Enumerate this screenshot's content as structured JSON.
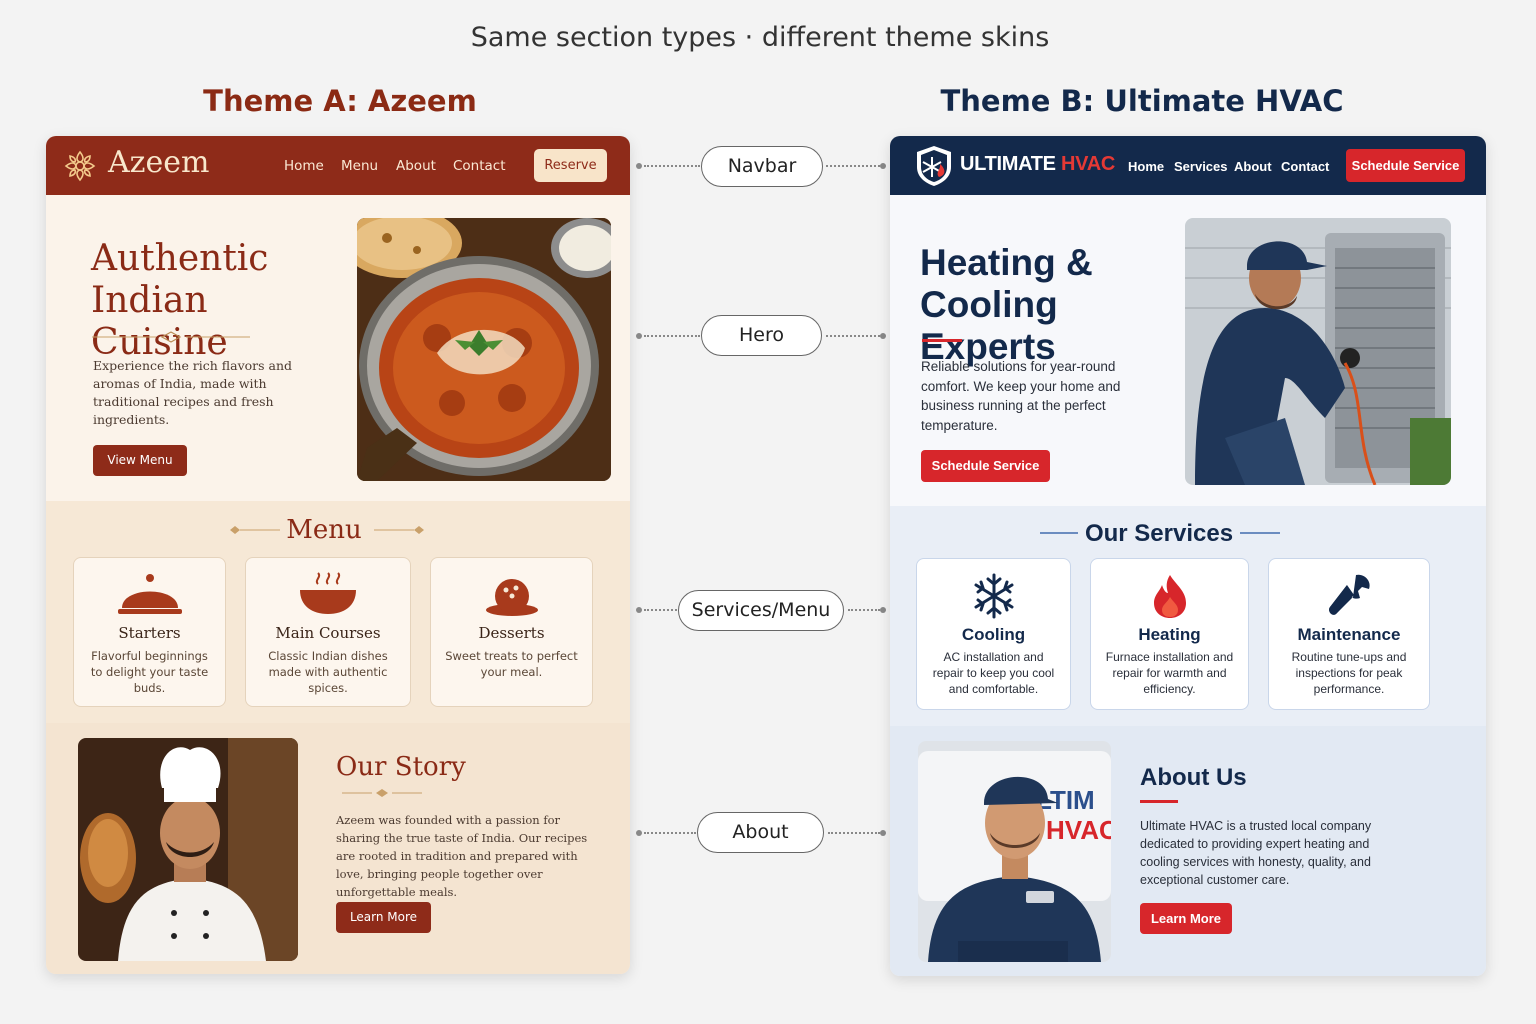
{
  "header": {
    "title": "Same section types  ·  different theme skins"
  },
  "theme_a": {
    "label": "Theme A: Azeem",
    "nav": {
      "logo": "Azeem",
      "links": [
        "Home",
        "Menu",
        "About",
        "Contact"
      ],
      "cta": "Reserve"
    },
    "hero": {
      "title": "Authentic Indian Cuisine",
      "description": "Experience the rich flavors and aromas of India, made with traditional recipes and fresh ingredients.",
      "button": "View Menu"
    },
    "menu": {
      "title": "Menu",
      "items": [
        {
          "title": "Starters",
          "desc": "Flavorful beginnings to delight your taste buds.",
          "icon": "cloche-icon"
        },
        {
          "title": "Main Courses",
          "desc": "Classic Indian dishes made with authentic spices.",
          "icon": "bowl-icon"
        },
        {
          "title": "Desserts",
          "desc": "Sweet treats to perfect your meal.",
          "icon": "dessert-icon"
        }
      ]
    },
    "about": {
      "title": "Our Story",
      "text": "Azeem was founded with a passion for sharing the true taste of India. Our recipes are rooted in tradition and prepared with love, bringing people together over unforgettable meals.",
      "button": "Learn More"
    },
    "colors": {
      "primary": "#8e2b19",
      "background": "#fbf3e9"
    }
  },
  "theme_b": {
    "label": "Theme B: Ultimate HVAC",
    "nav": {
      "logo_main": "ULTIMATE",
      "logo_accent": "HVAC",
      "links": [
        "Home",
        "Services",
        "About",
        "Contact"
      ],
      "cta": "Schedule Service"
    },
    "hero": {
      "title": "Heating & Cooling Experts",
      "description": "Reliable solutions for year-round comfort. We keep your home and business running at the perfect temperature.",
      "button": "Schedule Service"
    },
    "services": {
      "title": "Our Services",
      "items": [
        {
          "title": "Cooling",
          "desc": "AC installation and repair to keep you cool and comfortable.",
          "icon": "snowflake-icon"
        },
        {
          "title": "Heating",
          "desc": "Furnace installation and repair for warmth and efficiency.",
          "icon": "flame-icon"
        },
        {
          "title": "Maintenance",
          "desc": "Routine tune-ups and inspections for peak performance.",
          "icon": "wrench-icon"
        }
      ]
    },
    "about": {
      "title": "About Us",
      "text": "Ultimate HVAC is a trusted local company dedicated to providing expert heating and cooling services with honesty, quality, and exceptional customer care.",
      "button": "Learn More"
    },
    "colors": {
      "primary": "#13294b",
      "accent": "#d7262b",
      "background": "#f7f8fb"
    }
  },
  "connectors": [
    "Navbar",
    "Hero",
    "Services/Menu",
    "About"
  ]
}
